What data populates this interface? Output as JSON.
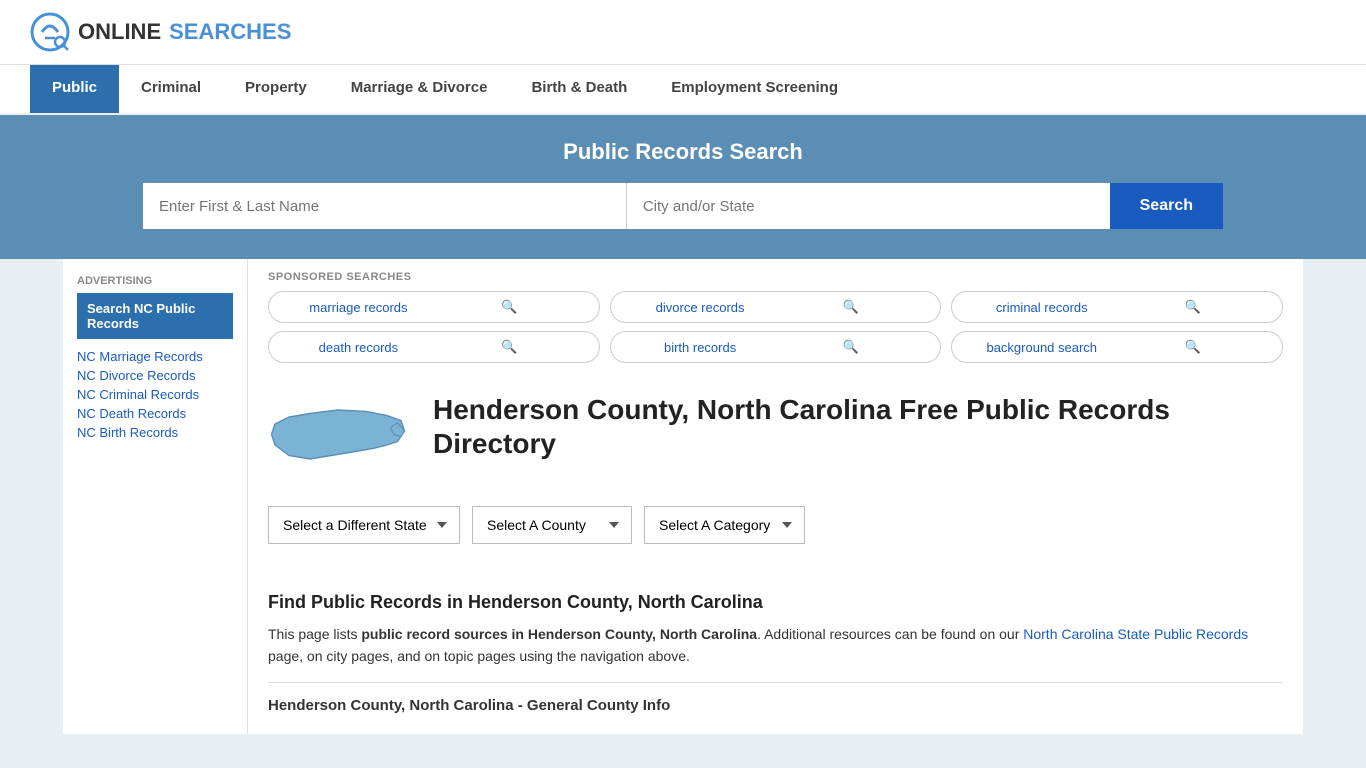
{
  "logo": {
    "text_online": "ONLINE",
    "text_searches": "SEARCHES"
  },
  "nav": {
    "items": [
      {
        "label": "Public",
        "active": true
      },
      {
        "label": "Criminal",
        "active": false
      },
      {
        "label": "Property",
        "active": false
      },
      {
        "label": "Marriage & Divorce",
        "active": false
      },
      {
        "label": "Birth & Death",
        "active": false
      },
      {
        "label": "Employment Screening",
        "active": false
      }
    ]
  },
  "hero": {
    "title": "Public Records Search",
    "name_placeholder": "Enter First & Last Name",
    "location_placeholder": "City and/or State",
    "search_button": "Search"
  },
  "sponsored": {
    "label": "SPONSORED SEARCHES",
    "pills": [
      {
        "text": "marriage records"
      },
      {
        "text": "divorce records"
      },
      {
        "text": "criminal records"
      },
      {
        "text": "death records"
      },
      {
        "text": "birth records"
      },
      {
        "text": "background search"
      }
    ]
  },
  "directory": {
    "title": "Henderson County, North Carolina Free Public Records Directory",
    "dropdowns": {
      "state": "Select a Different State",
      "county": "Select A County",
      "category": "Select A Category"
    }
  },
  "find_section": {
    "title": "Find Public Records in Henderson County, North Carolina",
    "text_part1": "This page lists ",
    "text_bold": "public record sources in Henderson County, North Carolina",
    "text_part2": ". Additional resources can be found on our ",
    "link_text": "North Carolina State Public Records",
    "text_part3": " page, on city pages, and on topic pages using the navigation above.",
    "county_info_title": "Henderson County, North Carolina - General County Info"
  },
  "sidebar": {
    "ad_label": "Advertising",
    "ad_box_text": "Search NC Public Records",
    "links": [
      {
        "text": "NC Marriage Records"
      },
      {
        "text": "NC Divorce Records"
      },
      {
        "text": "NC Criminal Records"
      },
      {
        "text": "NC Death Records"
      },
      {
        "text": "NC Birth Records"
      }
    ]
  },
  "colors": {
    "hero_bg": "#5a8eb5",
    "search_btn": "#1a5bbf",
    "nav_active_bg": "#2c6fad",
    "sidebar_box_bg": "#2c6fad"
  }
}
